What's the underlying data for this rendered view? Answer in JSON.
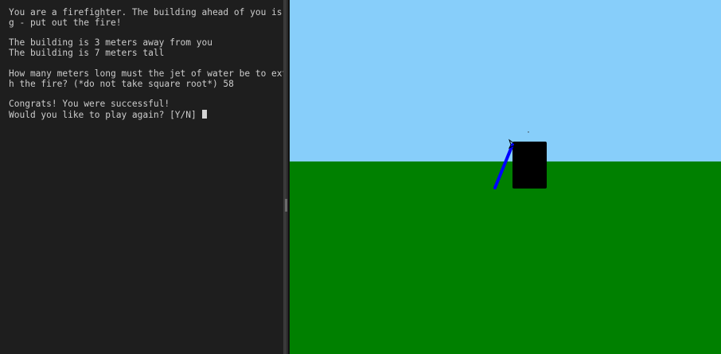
{
  "console": {
    "lines": [
      "You are a firefighter. The building ahead of you is burnin",
      "g - put out the fire!",
      "",
      "The building is 3 meters away from you",
      "The building is 7 meters tall",
      "",
      "How many meters long must the jet of water be to extinguis",
      "h the fire? (*do not take square root*) 58",
      "",
      "Congrats! You were successful!",
      "Would you like to play again? [Y/N] "
    ]
  },
  "scene": {
    "sky_color": "#87cefa",
    "ground_color": "#008000",
    "building_color": "#000000",
    "jet_color": "#0000ff"
  }
}
